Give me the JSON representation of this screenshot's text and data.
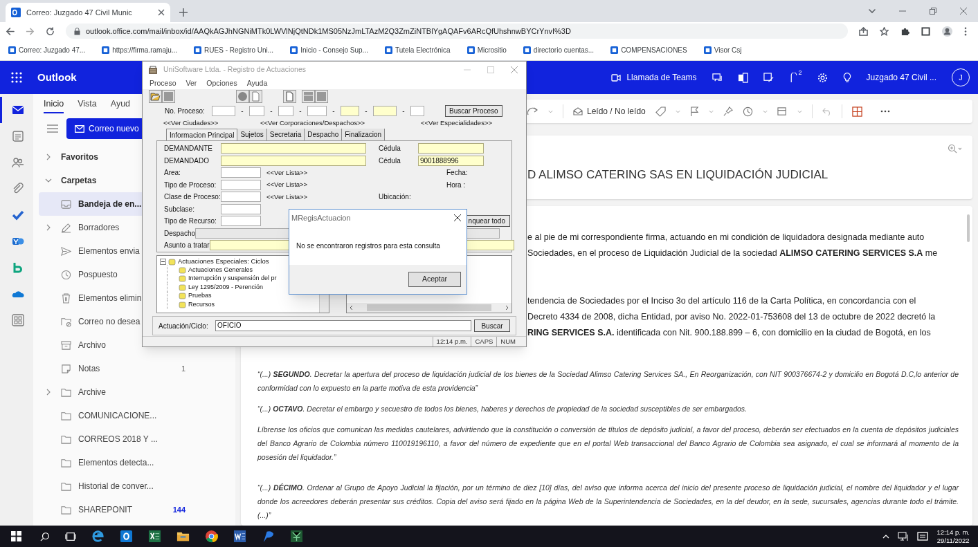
{
  "browser": {
    "tabs": [
      {
        "title": "Correo: Juzgado 47 Civil Munic",
        "selected": true
      }
    ],
    "address": "outlook.office.com/mail/inbox/id/AAQkAGJhNGNiMTk0LWVlNjQtNDk1MS05NzJmLTAzM2Q3ZmZiNTBlYgAQAFv6ARcQfUhshnwBYCrYnvI%3D",
    "bookmarks": [
      "Correo: Juzgado 47...",
      "https://firma.ramaju...",
      "RUES - Registro Uni...",
      "Inicio - Consejo Sup...",
      "Tutela Electrónica",
      "Micrositio",
      "directorio cuentas...",
      "COMPENSACIONES",
      "Visor Csj"
    ]
  },
  "outlook": {
    "app_name": "Outlook",
    "teams_call": "Llamada de Teams",
    "notification_count": "2",
    "account": "Juzgado 47 Civil ...",
    "avatar": "J",
    "rail": [
      {
        "kind": "mail",
        "selected": true
      },
      {
        "kind": "calendar",
        "selected": false
      },
      {
        "kind": "people",
        "selected": false
      },
      {
        "kind": "attach",
        "selected": false
      },
      {
        "kind": "todo",
        "selected": false
      },
      {
        "kind": "yammer",
        "selected": false
      },
      {
        "kind": "bookings",
        "selected": false
      },
      {
        "kind": "onedrive",
        "selected": false
      },
      {
        "kind": "apps",
        "selected": false
      }
    ],
    "ribbon_tabs": [
      {
        "label": "Inicio",
        "selected": true
      },
      {
        "label": "Vista",
        "selected": false
      },
      {
        "label": "Ayud",
        "selected": false
      }
    ],
    "new_mail": "Correo nuevo",
    "folders": [
      {
        "label": "Favoritos",
        "kind": "section",
        "has_subfolders": true,
        "expanded": false,
        "selected": false
      },
      {
        "label": "Carpetas",
        "kind": "section",
        "has_subfolders": true,
        "expanded": true,
        "selected": false
      },
      {
        "label": "Bandeja de en...",
        "kind": "inbox",
        "has_subfolders": false,
        "selected": true
      },
      {
        "label": "Borradores",
        "kind": "drafts",
        "has_subfolders": true,
        "expanded": false,
        "selected": false
      },
      {
        "label": "Elementos envia",
        "kind": "sent",
        "has_subfolders": false,
        "selected": false
      },
      {
        "label": "Pospuesto",
        "kind": "snoozed",
        "has_subfolders": false,
        "selected": false
      },
      {
        "label": "Elementos elimin",
        "kind": "deleted",
        "has_subfolders": false,
        "selected": false
      },
      {
        "label": "Correo no desea",
        "kind": "junk",
        "has_subfolders": false,
        "selected": false
      },
      {
        "label": "Archivo",
        "kind": "archive",
        "has_subfolders": false,
        "selected": false
      },
      {
        "label": "Notas",
        "kind": "notes",
        "count": "1",
        "has_subfolders": false,
        "selected": false
      },
      {
        "label": "Archive",
        "kind": "folder",
        "has_subfolders": true,
        "expanded": false,
        "selected": false
      },
      {
        "label": "COMUNICACIONE...",
        "kind": "folder",
        "has_subfolders": false,
        "selected": false
      },
      {
        "label": "CORREOS 2018 Y ...",
        "kind": "folder",
        "has_subfolders": false,
        "selected": false
      },
      {
        "label": "Elementos detecta...",
        "kind": "folder",
        "has_subfolders": false,
        "selected": false
      },
      {
        "label": "Historial de conver...",
        "kind": "folder",
        "has_subfolders": false,
        "selected": false
      },
      {
        "label": "SHAREPONIT",
        "kind": "folder",
        "count": "144",
        "has_subfolders": false,
        "selected": false
      }
    ],
    "read_toggle": "Leído / No leído",
    "subject": "D ALIMSO CATERING SAS EN LIQUIDACIÓN JUDICIAL",
    "body_paragraphs": [
      [
        "e al pie de mi correspondiente firma, actuando en mi condición de liquidadora designada mediante auto",
        "Sociedades, en el proceso de Liquidación Judicial de la sociedad **ALIMSO CATERING SERVICES S.A** me"
      ],
      [
        "tendencia de Sociedades por el Inciso 3o del artículo 116 de la Carta Política, en concordancia con el",
        "Decreto 4334 de 2008, dicha Entidad, por aviso No. 2022-01-753608 del 13 de octubre de 2022 decretó la",
        "**RING SERVICES S.A.** identificada con Nit. 900.188.899 – 6, con domicilio en la ciudad de Bogotá, en los"
      ]
    ],
    "quotes": [
      "“(...) **SEGUNDO**. Decretar la apertura del proceso de liquidación judicial de los bienes de la Sociedad Alimso Catering Services SA., En Reorganización, con NIT 900376674-2 y domicilio en Bogotá D.C,lo anterior de conformidad con lo expuesto en la parte motiva de esta providencia”",
      "“(...) **OCTAVO**. Decretar el embargo y secuestro de todos los bienes, haberes y derechos de propiedad de la sociedad susceptibles de ser embargados.",
      "Líbrense los oficios que comunican las medidas cautelares, advirtiendo que la constitución o conversión de títulos de depósito judicial, a favor del proceso, deberán ser efectuados en la cuenta de depósitos judiciales del Banco Agrario de Colombia número 110019196110, a favor del número de expediente que en el portal Web transaccional del Banco Agrario de Colombia sea asignado, el cual se informará al momento de la posesión del liquidador.”",
      "“(...) **DÉCIMO**. Ordenar al Grupo de Apoyo Judicial la fijación, por un término de diez [10] días, del aviso que informa acerca del inicio del presente proceso de liquidación judicial, el nombre del liquidador y el lugar donde los acreedores deberán presentar sus créditos. Copia del aviso será fijado en la página Web de la Superintendencia de Sociedades, en la del deudor, en la sede, sucursales, agencias durante todo el trámite. (...)”"
    ]
  },
  "uni_dialog": {
    "title": "UniSoftware Ltda. - Registro de Actuaciones",
    "menu": [
      "Proceso",
      "Ver",
      "Opciones",
      "Ayuda"
    ],
    "process_number": {
      "label": "No. Proceso:",
      "separator": "-",
      "segments": [
        {
          "required": false
        },
        {
          "required": false
        },
        {
          "required": false
        },
        {
          "required": false
        },
        {
          "required": true
        },
        {
          "required": true
        },
        {
          "required": false
        }
      ],
      "button": "Buscar Proceso"
    },
    "links": [
      "<<Ver Ciudades>>",
      "<<Ver Corporaciones/Despachos>>",
      "<<Ver Especialidades>>"
    ],
    "tabs": [
      {
        "label": "Informacion Principal",
        "selected": true
      },
      {
        "label": "Sujetos",
        "selected": false
      },
      {
        "label": "Secretaria",
        "selected": false
      },
      {
        "label": "Despacho",
        "selected": false
      },
      {
        "label": "Finalizacion",
        "selected": false
      }
    ],
    "form_rows": [
      {
        "label": "DEMANDANTE",
        "required": true,
        "disabled": false,
        "aside": {
          "kind": "field",
          "label": "Cédula",
          "required": true
        }
      },
      {
        "label": "DEMANDADO",
        "required": true,
        "disabled": false,
        "aside": {
          "kind": "field",
          "label": "Cédula",
          "required": true,
          "value": "9001888996"
        }
      },
      {
        "label": "Area:",
        "required": false,
        "disabled": false,
        "link": "<<Ver Lista>>",
        "aside": {
          "kind": "stamp",
          "label": "Fecha:"
        }
      },
      {
        "label": "Tipo de Proceso:",
        "required": false,
        "disabled": false,
        "link": "<<Ver Lista>>",
        "aside": {
          "kind": "stamp",
          "label": "Hora :"
        }
      },
      {
        "label": "Clase de Proceso:",
        "required": false,
        "disabled": false,
        "link": "<<Ver Lista>>",
        "aside": {
          "kind": "label",
          "label": "Ubicación:"
        }
      },
      {
        "label": "Subclase:",
        "required": false,
        "disabled": false
      },
      {
        "label": "Tipo de Recurso:",
        "required": false,
        "disabled": false,
        "aside": {
          "kind": "button",
          "label": "nquear todo"
        }
      },
      {
        "label": "Despacho",
        "required": false,
        "disabled": true
      },
      {
        "label": "Asunto a tratar",
        "required": true,
        "disabled": false
      }
    ],
    "tree": [
      {
        "label": "Actuaciones Especiales: Ciclos",
        "expanded": true,
        "children": [
          {
            "label": "Actuaciones Generales"
          },
          {
            "label": "Interrupción  y suspensión del pr"
          },
          {
            "label": "Ley 1295/2009 - Perención"
          },
          {
            "label": "Pruebas"
          },
          {
            "label": "Recursos"
          }
        ]
      }
    ],
    "search": {
      "label": "Actuación/Ciclo:",
      "value": "OFICIO",
      "button": "Buscar"
    },
    "status": [
      "12:14 p.m.",
      "CAPS",
      "NUM"
    ]
  },
  "message_box": {
    "title": "MRegisActuacion",
    "text": "No se encontraron registros para esta consulta",
    "button": "Aceptar"
  },
  "taskbar": {
    "apps": [
      {
        "kind": "ie"
      },
      {
        "kind": "outlook"
      },
      {
        "kind": "excel"
      },
      {
        "kind": "explorer"
      },
      {
        "kind": "chrome"
      },
      {
        "kind": "word"
      },
      {
        "kind": "pen"
      },
      {
        "kind": "green"
      }
    ],
    "time": "12:14 p. m.",
    "date": "29/11/2022"
  }
}
